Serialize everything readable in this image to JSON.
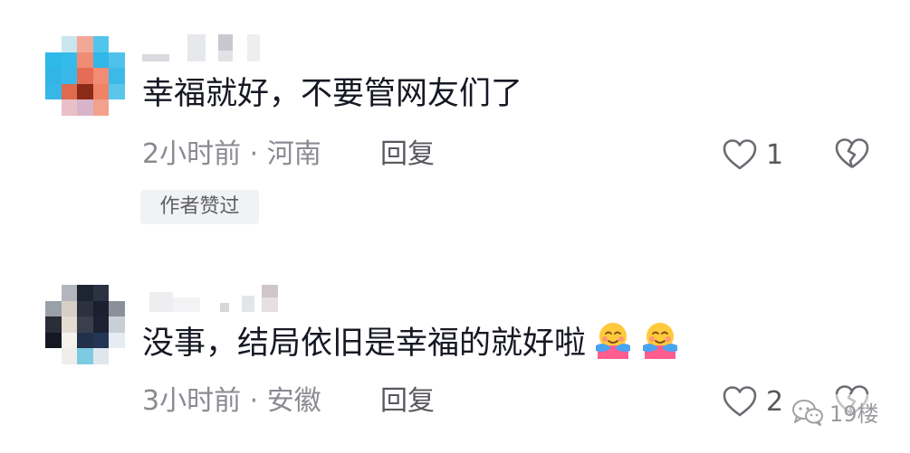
{
  "comments": [
    {
      "text": "幸福就好，不要管网友们了",
      "time": "2小时前",
      "separator": "·",
      "location": "河南",
      "reply_label": "回复",
      "like_count": "1",
      "author_badge": "作者赞过"
    },
    {
      "text": "没事，结局依旧是幸福的就好啦",
      "time": "3小时前",
      "separator": "·",
      "location": "安徽",
      "reply_label": "回复",
      "like_count": "2",
      "emojis": [
        "hug-emoji",
        "hug-emoji"
      ]
    }
  ],
  "watermark": {
    "text": "19楼",
    "icon": "wechat-icon"
  },
  "colors": {
    "primary_text": "#161823",
    "secondary_text": "#8a8b91",
    "action_text": "#57585e",
    "badge_bg": "#f1f2f4"
  }
}
